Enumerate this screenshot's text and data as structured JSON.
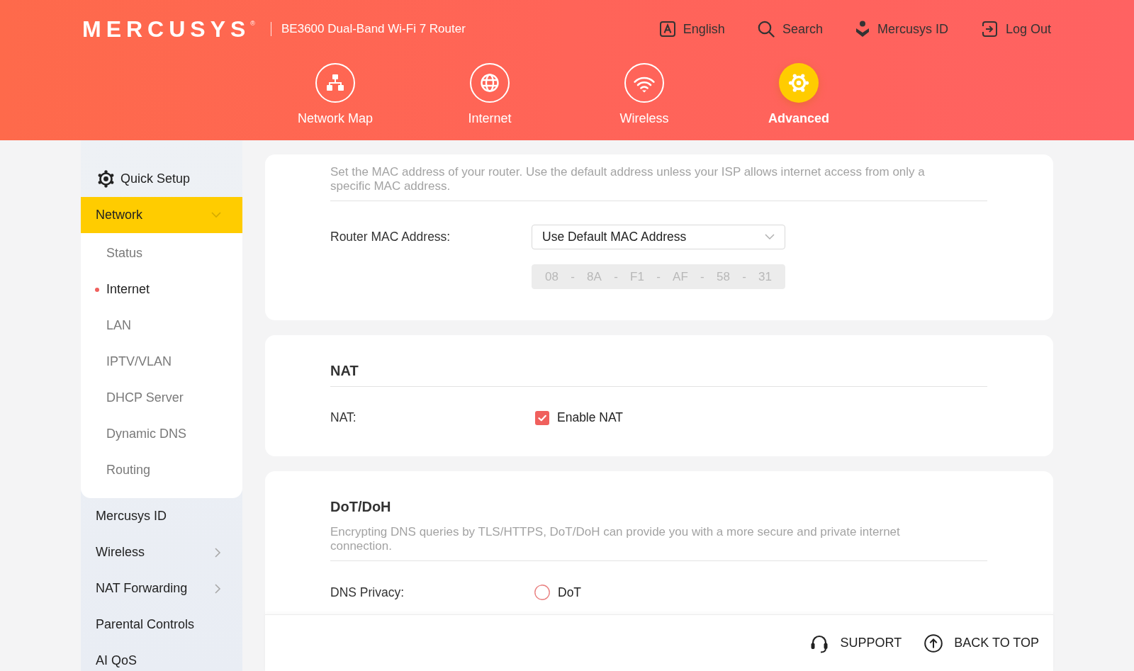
{
  "header": {
    "logo": "MERCUSYS$^{®}$",
    "product": "BE3600 Dual-Band Wi-Fi 7 Router",
    "links": [
      {
        "kind": "language",
        "label": "English"
      },
      {
        "kind": "search",
        "label": "Search"
      },
      {
        "kind": "account",
        "label": "Mercusys ID"
      },
      {
        "kind": "logout",
        "label": "Log Out"
      }
    ]
  },
  "nav_tabs": [
    {
      "kind": "network-map",
      "label": "Network Map",
      "selected": false
    },
    {
      "kind": "internet",
      "label": "Internet",
      "selected": false
    },
    {
      "kind": "wireless",
      "label": "Wireless",
      "selected": false
    },
    {
      "kind": "advanced",
      "label": "Advanced",
      "selected": true
    }
  ],
  "sidebar": {
    "items": [
      {
        "kind": "setup",
        "label": "Quick Setup",
        "selected": false
      },
      {
        "kind": "group",
        "label": "Network",
        "selected": true,
        "expanded": true,
        "children": [
          {
            "label": "Status",
            "selected": false
          },
          {
            "label": "Internet",
            "selected": true
          },
          {
            "label": "LAN",
            "selected": false
          },
          {
            "label": "IPTV/VLAN",
            "selected": false
          },
          {
            "label": "DHCP Server",
            "selected": false
          },
          {
            "label": "Dynamic DNS",
            "selected": false
          },
          {
            "label": "Routing",
            "selected": false
          }
        ]
      },
      {
        "kind": "link",
        "label": "Mercusys ID",
        "selected": false
      },
      {
        "kind": "group",
        "label": "Wireless",
        "selected": false,
        "expanded": false
      },
      {
        "kind": "group",
        "label": "NAT Forwarding",
        "selected": false,
        "expanded": false
      },
      {
        "kind": "link",
        "label": "Parental Controls",
        "selected": false
      },
      {
        "kind": "link",
        "label": "AI QoS",
        "selected": false
      }
    ]
  },
  "sections": [
    {
      "description": "Set the MAC address of your router. Use the default address unless your ISP allows internet access from only a specific MAC address.",
      "rows": [
        {
          "kind": "select",
          "label": "Router MAC Address:",
          "value": "Use Default MAC Address"
        },
        {
          "kind": "mac",
          "disabled": true,
          "octets": [
            "08",
            "8A",
            "F1",
            "AF",
            "58",
            "31"
          ],
          "separators": [
            "-",
            "-",
            "-",
            "-",
            "-"
          ]
        }
      ]
    },
    {
      "title": "NAT",
      "rows": [
        {
          "kind": "checkbox",
          "label": "NAT:",
          "option": "Enable NAT",
          "checked": true
        }
      ]
    },
    {
      "title": "DoT/DoH",
      "description": "Encrypting DNS queries by TLS/HTTPS, DoT/DoH can provide you with a more secure and private internet connection.",
      "rows": [
        {
          "kind": "radio",
          "label": "DNS Privacy:",
          "option": "DoT",
          "selected": false
        }
      ]
    }
  ],
  "footer": {
    "links": [
      {
        "kind": "support",
        "label": "SUPPORT"
      },
      {
        "kind": "back-to-top",
        "label": "BACK TO TOP"
      }
    ]
  }
}
